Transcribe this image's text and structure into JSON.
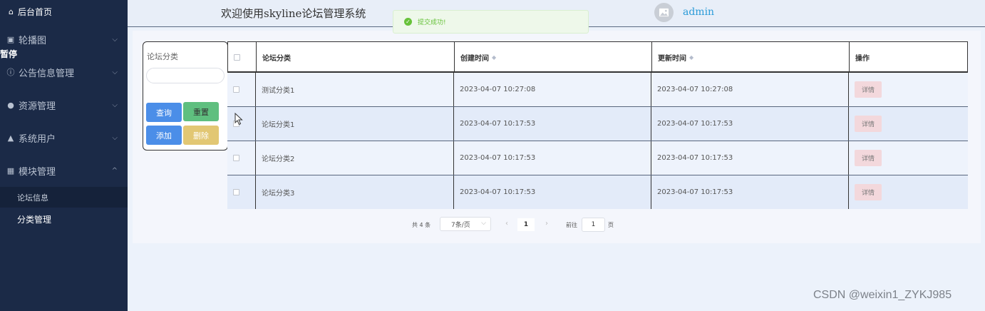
{
  "sidebar": {
    "home": "后台首页",
    "pause_label": "暂停",
    "menus": [
      {
        "label": "轮播图",
        "icon": "image-icon",
        "chevron": "⌵"
      },
      {
        "label": "公告信息管理",
        "icon": "info-circle-icon",
        "chevron": "⌵"
      },
      {
        "label": "资源管理",
        "icon": "bulb-icon",
        "chevron": "⌵"
      },
      {
        "label": "系统用户",
        "icon": "user-icon",
        "chevron": "⌵"
      },
      {
        "label": "模块管理",
        "icon": "grid-icon",
        "chevron": "^"
      }
    ],
    "submenu": [
      "论坛信息",
      "分类管理"
    ]
  },
  "header": {
    "welcome": "欢迎使用skyline论坛管理系统",
    "username": "admin"
  },
  "toast": {
    "message": "提交成功!"
  },
  "search": {
    "label": "论坛分类",
    "value": "",
    "buttons": {
      "query": "查询",
      "reset": "重置",
      "add": "添加",
      "delete": "删除"
    }
  },
  "table": {
    "columns": [
      "论坛分类",
      "创建时间",
      "更新时间",
      "操作"
    ],
    "rows": [
      {
        "category": "测试分类1",
        "created": "2023-04-07 10:27:08",
        "updated": "2023-04-07 10:27:08",
        "action": "详情"
      },
      {
        "category": "论坛分类1",
        "created": "2023-04-07 10:17:53",
        "updated": "2023-04-07 10:17:53",
        "action": "详情"
      },
      {
        "category": "论坛分类2",
        "created": "2023-04-07 10:17:53",
        "updated": "2023-04-07 10:17:53",
        "action": "详情"
      },
      {
        "category": "论坛分类3",
        "created": "2023-04-07 10:17:53",
        "updated": "2023-04-07 10:17:53",
        "action": "详情"
      }
    ]
  },
  "pagination": {
    "total": "共 4 条",
    "page_size": "7条/页",
    "current_page": "1",
    "goto_label": "前往",
    "goto_value": "1",
    "page_suffix": "页"
  },
  "watermark": "CSDN @weixin1_ZYKJ985",
  "colors": {
    "sidebar_bg": "#1b2a47",
    "primary": "#4b8ee8",
    "success": "#5fbf7f",
    "warning": "#e2c773",
    "link": "#2a9bd8"
  }
}
